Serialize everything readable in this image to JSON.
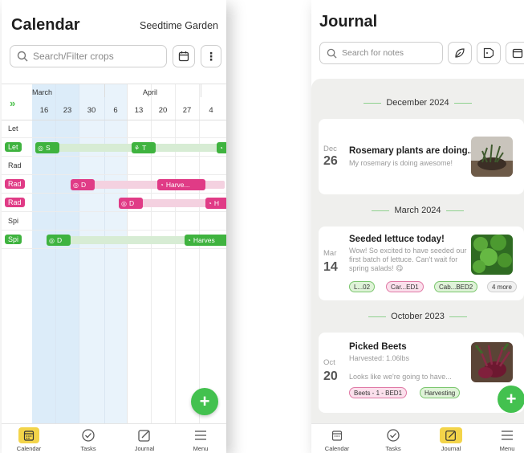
{
  "calendar": {
    "title": "Calendar",
    "garden": "Seedtime Garden",
    "search_placeholder": "Search/Filter crops",
    "months": [
      "March",
      "April"
    ],
    "days": [
      "16",
      "23",
      "30",
      "6",
      "13",
      "20",
      "27",
      "4"
    ],
    "rows": [
      {
        "label": "Let",
        "style": "plain"
      },
      {
        "label": "Let",
        "style": "green"
      },
      {
        "label": "Rad",
        "style": "plain"
      },
      {
        "label": "Rad",
        "style": "pink"
      },
      {
        "label": "Rad",
        "style": "pink"
      },
      {
        "label": "Spi",
        "style": "plain"
      },
      {
        "label": "Spi",
        "style": "green"
      }
    ],
    "tags": {
      "let_s": "S",
      "let_t": "T",
      "rad1_d": "D",
      "rad1_h": "Harve...",
      "rad2_d": "D",
      "rad2_h": "H",
      "spi_d": "D",
      "spi_h": "Harves"
    },
    "fab": "+"
  },
  "journal": {
    "title": "Journal",
    "search_placeholder": "Search for notes",
    "sections": {
      "dec": "December 2024",
      "mar": "March 2024",
      "oct": "October 2023"
    },
    "entries": [
      {
        "month": "Dec",
        "day": "26",
        "title": "Rosemary plants are doing...",
        "body": "My rosemary is doing awesome!"
      },
      {
        "month": "Mar",
        "day": "14",
        "title": "Seeded lettuce today!",
        "body": "Wow! So excited to have seeded our first batch of lettuce. Can't wait for spring salads! 😋",
        "chips": [
          "L...02",
          "Car...ED1",
          "Cab...BED2",
          "4 more"
        ]
      },
      {
        "month": "Oct",
        "day": "20",
        "title": "Picked Beets",
        "subtitle": "Harvested: 1.06lbs",
        "body": "Looks like we're going to have...",
        "chips": [
          "Beets - 1 - BED1",
          "Harvesting"
        ]
      }
    ],
    "fab": "+"
  },
  "nav": {
    "calendar": "Calendar",
    "tasks": "Tasks",
    "journal": "Journal",
    "menu": "Menu"
  },
  "colors": {
    "green": "#3fb33f",
    "pink": "#e03b86",
    "active_nav": "#f3d44a",
    "column_highlight": "#dcecf9"
  }
}
